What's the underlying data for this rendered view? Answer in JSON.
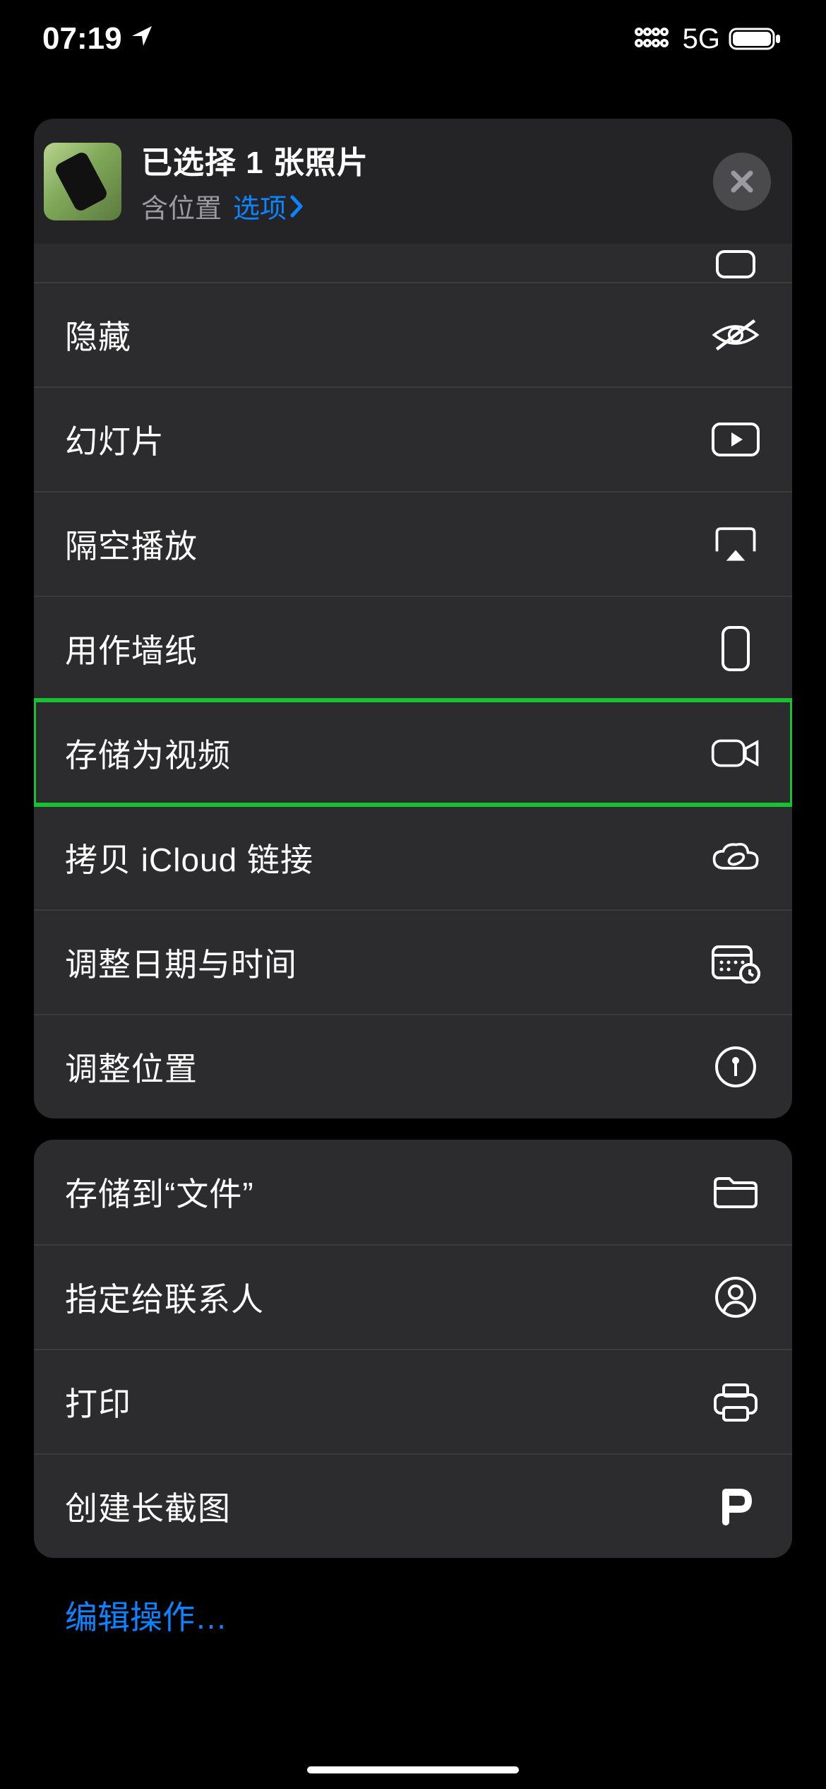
{
  "status": {
    "time": "07:19",
    "network": "5G"
  },
  "header": {
    "title": "已选择 1 张照片",
    "location_label": "含位置",
    "options_label": "选项"
  },
  "actions": {
    "group1": [
      {
        "label": "隐藏",
        "icon": "eye-slash-icon"
      },
      {
        "label": "幻灯片",
        "icon": "play-rectangle-icon"
      },
      {
        "label": "隔空播放",
        "icon": "airplay-icon"
      },
      {
        "label": "用作墙纸",
        "icon": "phone-icon"
      },
      {
        "label": "存储为视频",
        "icon": "video-icon",
        "highlighted": true
      },
      {
        "label": "拷贝 iCloud 链接",
        "icon": "cloud-link-icon"
      },
      {
        "label": "调整日期与时间",
        "icon": "calendar-clock-icon"
      },
      {
        "label": "调整位置",
        "icon": "pin-circle-icon"
      }
    ],
    "group2": [
      {
        "label": "存储到“文件”",
        "icon": "folder-icon"
      },
      {
        "label": "指定给联系人",
        "icon": "person-circle-icon"
      },
      {
        "label": "打印",
        "icon": "printer-icon"
      },
      {
        "label": "创建长截图",
        "icon": "p-icon"
      }
    ]
  },
  "edit_actions_label": "编辑操作…"
}
